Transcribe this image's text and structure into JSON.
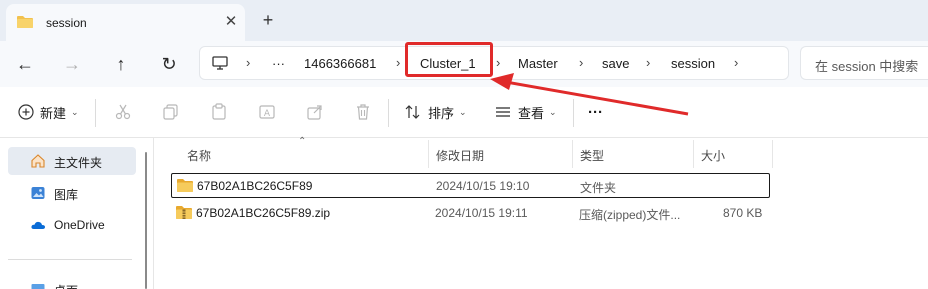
{
  "tab": {
    "title": "session",
    "close_glyph": "✕",
    "add_glyph": "+"
  },
  "nav": {
    "back": "←",
    "forward": "→",
    "up": "↑",
    "refresh": "↻"
  },
  "breadcrumb": {
    "overflow": "···",
    "items": [
      "1466366681",
      "Cluster_1",
      "Master",
      "save",
      "session"
    ],
    "separator": "›"
  },
  "search": {
    "placeholder": "在 session 中搜索"
  },
  "toolbar": {
    "new_label": "新建",
    "sort_label": "排序",
    "view_label": "查看",
    "more_label": "···",
    "caret": "⌄"
  },
  "sidebar": {
    "items": [
      {
        "label": "主文件夹",
        "icon": "home-icon",
        "selected": true
      },
      {
        "label": "图库",
        "icon": "gallery-icon",
        "selected": false
      },
      {
        "label": "OneDrive",
        "icon": "onedrive-icon",
        "selected": false
      },
      {
        "label": "桌面",
        "icon": "desktop-icon",
        "selected": false
      }
    ]
  },
  "columns": {
    "name": "名称",
    "modified": "修改日期",
    "type": "类型",
    "size": "大小"
  },
  "files": [
    {
      "name": "67B02A1BC26C5F89",
      "modified": "2024/10/15 19:10",
      "type": "文件夹",
      "size": "",
      "icon": "folder-icon"
    },
    {
      "name": "67B02A1BC26C5F89.zip",
      "modified": "2024/10/15 19:11",
      "type": "压缩(zipped)文件...",
      "size": "870 KB",
      "icon": "zip-folder-icon"
    }
  ],
  "colors": {
    "highlight": "#e02a2a",
    "folder": "#f2c14e",
    "accent": "#0a6cd6"
  }
}
